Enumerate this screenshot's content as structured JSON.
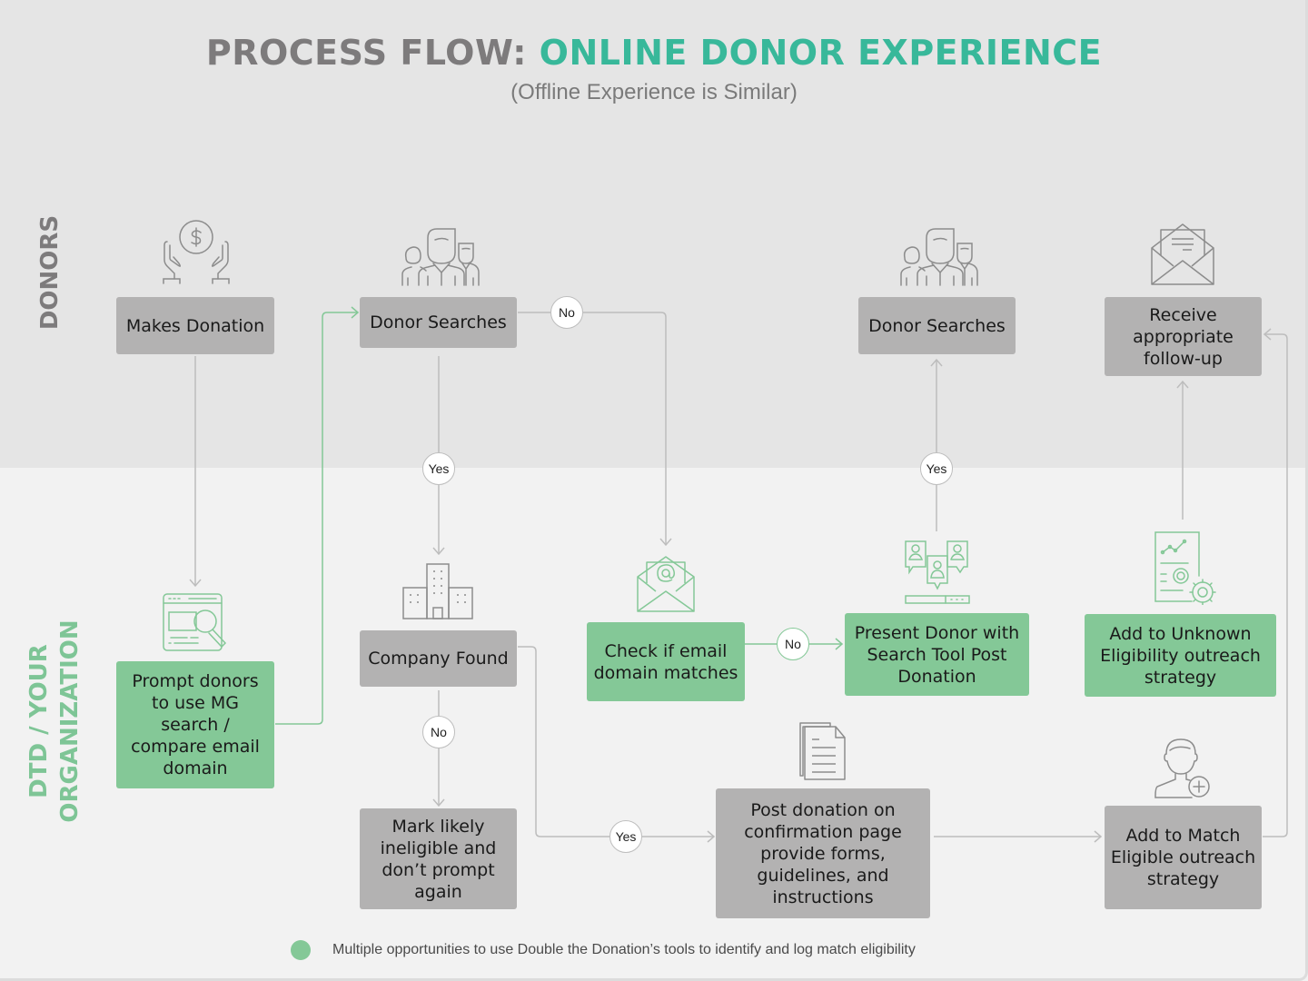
{
  "title": {
    "prefix": "PROCESS FLOW:",
    "highlight": "ONLINE DONOR EXPERIENCE",
    "subtitle": "(Offline Experience is Similar)"
  },
  "colors": {
    "title_gray": "#7d7b7c",
    "title_teal": "#38b89a",
    "gray_box": "#b3b2b2",
    "green_box": "#84c897",
    "top_band": "#e5e5e5",
    "bottom_band": "#f2f2f2"
  },
  "lanes": {
    "donors": "DONORS",
    "organization": "DTD / YOUR ORGANIZATION"
  },
  "nodes": {
    "makes_donation": {
      "label": "Makes Donation",
      "icon": "hands-dollar-icon",
      "type": "gray"
    },
    "donor_searches_1": {
      "label": "Donor Searches",
      "icon": "people-group-icon",
      "type": "gray"
    },
    "donor_searches_2": {
      "label": "Donor Searches",
      "icon": "people-group-icon",
      "type": "gray"
    },
    "receive_followup": {
      "label": "Receive appropriate follow-up",
      "icon": "open-envelope-icon",
      "type": "gray"
    },
    "prompt_donors": {
      "label": "Prompt donors to use MG search / compare email domain",
      "icon": "browser-search-icon",
      "type": "green"
    },
    "company_found": {
      "label": "Company Found",
      "icon": "office-building-icon",
      "type": "gray"
    },
    "check_email": {
      "label": "Check if email domain matches",
      "icon": "email-at-icon",
      "type": "green"
    },
    "present_donor": {
      "label": "Present Donor with Search Tool Post Donation",
      "icon": "profiles-search-icon",
      "type": "green"
    },
    "add_unknown": {
      "label": "Add to Unknown Eligibility outreach strategy",
      "icon": "report-gear-icon",
      "type": "green"
    },
    "mark_ineligible": {
      "label": "Mark likely ineligible and don’t prompt again",
      "type": "gray"
    },
    "post_confirmation": {
      "label": "Post donation on confirmation page provide forms, guidelines, and instructions",
      "icon": "documents-icon",
      "type": "gray"
    },
    "add_match": {
      "label": "Add to Match Eligible outreach strategy",
      "icon": "user-add-icon",
      "type": "gray"
    }
  },
  "decisions": {
    "searches_no": "No",
    "searches_yes": "Yes",
    "search2_yes": "Yes",
    "email_no": "No",
    "company_no": "No",
    "company_yes": "Yes"
  },
  "legend": {
    "text": "Multiple opportunities to use Double the Donation’s tools to identify and log match eligibility"
  }
}
